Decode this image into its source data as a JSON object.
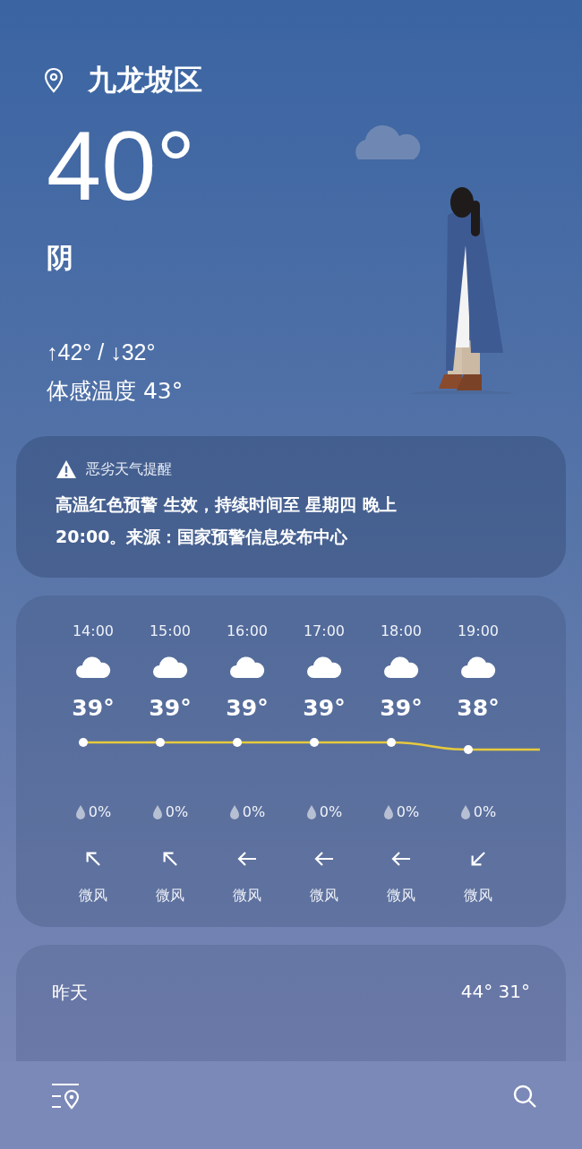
{
  "location": "九龙坡区",
  "current": {
    "temperature": "40°",
    "condition": "阴",
    "high_low": "↑42° / ↓32°",
    "feels_like": "体感温度 43°"
  },
  "alert": {
    "title": "恶劣天气提醒",
    "text": "高温红色预警 生效，持续时间至 星期四 晚上 20:00。来源：国家预警信息发布中心"
  },
  "hourly": [
    {
      "time": "14:00",
      "temp": "39°",
      "rain": "0%",
      "kind": "nw",
      "wind": "微风"
    },
    {
      "time": "15:00",
      "temp": "39°",
      "rain": "0%",
      "kind": "nw",
      "wind": "微风"
    },
    {
      "time": "16:00",
      "temp": "39°",
      "rain": "0%",
      "kind": "w",
      "wind": "微风"
    },
    {
      "time": "17:00",
      "temp": "39°",
      "rain": "0%",
      "kind": "w",
      "wind": "微风"
    },
    {
      "time": "18:00",
      "temp": "39°",
      "rain": "0%",
      "kind": "w",
      "wind": "微风"
    },
    {
      "time": "19:00",
      "temp": "38°",
      "rain": "0%",
      "kind": "sw",
      "wind": "微风"
    }
  ],
  "daily": [
    {
      "day": "昨天",
      "temps": "44° 31°"
    }
  ]
}
